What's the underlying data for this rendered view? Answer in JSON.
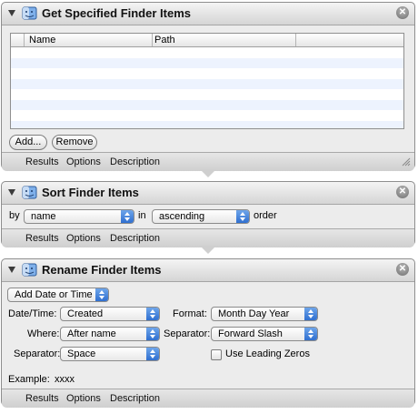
{
  "actions": [
    {
      "title": "Get Specified Finder Items",
      "table": {
        "columns": [
          "Name",
          "Path",
          ""
        ],
        "rows": []
      },
      "add_label": "Add...",
      "remove_label": "Remove",
      "footer": [
        "Results",
        "Options",
        "Description"
      ]
    },
    {
      "title": "Sort Finder Items",
      "by_label": "by",
      "by_value": "name",
      "in_label": "in",
      "order_value": "ascending",
      "order_label": "order",
      "footer": [
        "Results",
        "Options",
        "Description"
      ]
    },
    {
      "title": "Rename Finder Items",
      "mode_value": "Add Date or Time",
      "date_time_label": "Date/Time:",
      "date_time_value": "Created",
      "where_label": "Where:",
      "where_value": "After name",
      "separator_label": "Separator:",
      "separator_value": "Space",
      "format_label": "Format:",
      "format_value": "Month Day Year",
      "separator2_label": "Separator:",
      "separator2_value": "Forward Slash",
      "leading_zeros_label": "Use Leading Zeros",
      "leading_zeros_checked": false,
      "example_label": "Example:",
      "example_value": "xxxx",
      "footer": [
        "Results",
        "Options",
        "Description"
      ]
    }
  ],
  "icons": {
    "action_icon": "automator-finder-icon",
    "close_icon": "close-icon",
    "disclosure_icon": "disclosure-triangle-icon"
  },
  "colors": {
    "popup_arrow": "#3c7fdd",
    "row_stripe": "#edf3fe"
  }
}
